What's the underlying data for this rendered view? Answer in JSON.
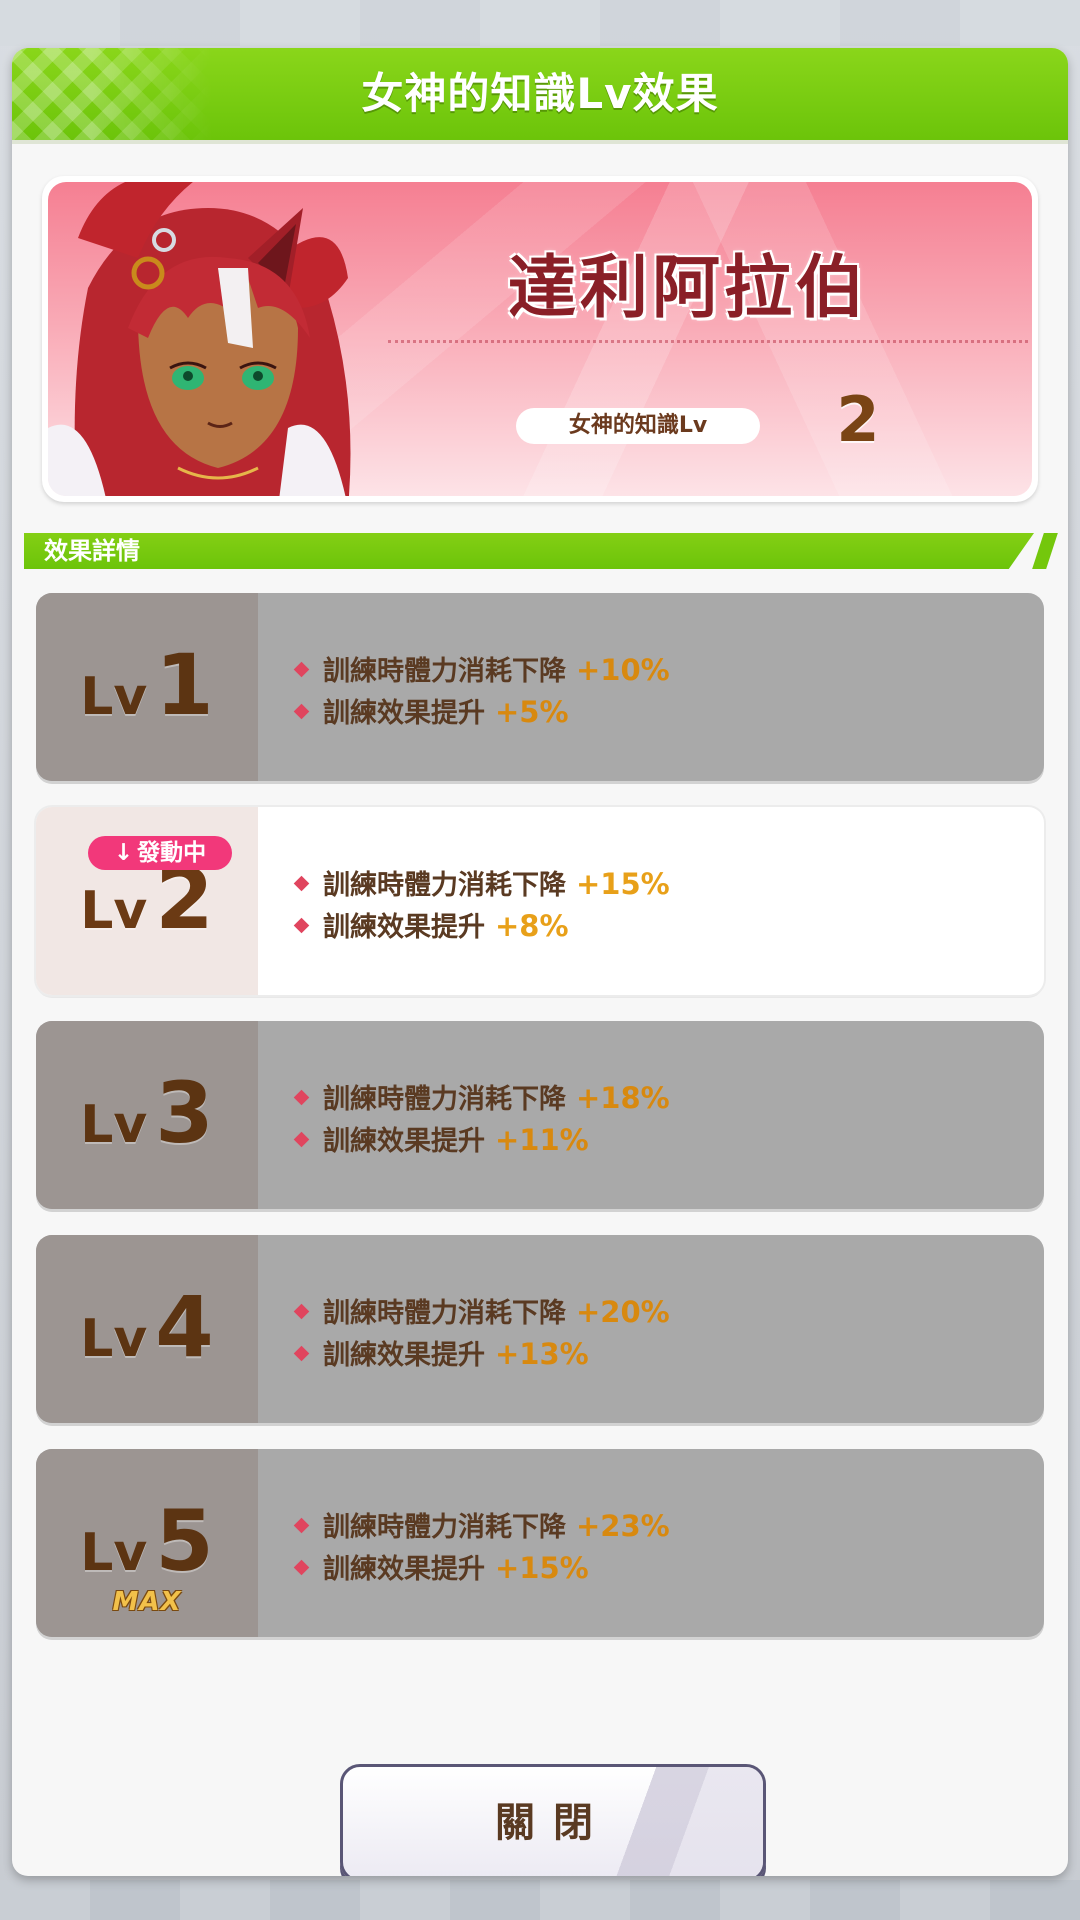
{
  "dialog": {
    "title": "女神的知識Lv效果"
  },
  "character": {
    "name": "達利阿拉伯",
    "knowledge_label": "女神的知識Lv",
    "knowledge_level": "2"
  },
  "section": {
    "title": "效果詳情"
  },
  "active_badge": {
    "arrow": "↓",
    "label": "發動中"
  },
  "levels": [
    {
      "lv_text": "Lv",
      "num": "1",
      "active": false,
      "effects": [
        {
          "label": "訓練時體力消耗下降",
          "value": "+10%"
        },
        {
          "label": "訓練效果提升",
          "value": "+5%"
        }
      ]
    },
    {
      "lv_text": "Lv",
      "num": "2",
      "active": true,
      "effects": [
        {
          "label": "訓練時體力消耗下降",
          "value": "+15%"
        },
        {
          "label": "訓練效果提升",
          "value": "+8%"
        }
      ]
    },
    {
      "lv_text": "Lv",
      "num": "3",
      "active": false,
      "effects": [
        {
          "label": "訓練時體力消耗下降",
          "value": "+18%"
        },
        {
          "label": "訓練效果提升",
          "value": "+11%"
        }
      ]
    },
    {
      "lv_text": "Lv",
      "num": "4",
      "active": false,
      "effects": [
        {
          "label": "訓練時體力消耗下降",
          "value": "+20%"
        },
        {
          "label": "訓練效果提升",
          "value": "+13%"
        }
      ]
    },
    {
      "lv_text": "Lv",
      "num": "5",
      "active": false,
      "max_label": "MAX",
      "effects": [
        {
          "label": "訓練時體力消耗下降",
          "value": "+23%"
        },
        {
          "label": "訓練效果提升",
          "value": "+15%"
        }
      ]
    }
  ],
  "close_button": {
    "label": "關閉"
  },
  "colors": {
    "header_green": "#7ccd12",
    "active_badge_pink": "#f2387a",
    "effect_value_orange": "#e8a019",
    "name_red": "#8a1f27"
  },
  "icons": {
    "bullet": "diamond-icon",
    "active": "down-arrow-icon"
  }
}
